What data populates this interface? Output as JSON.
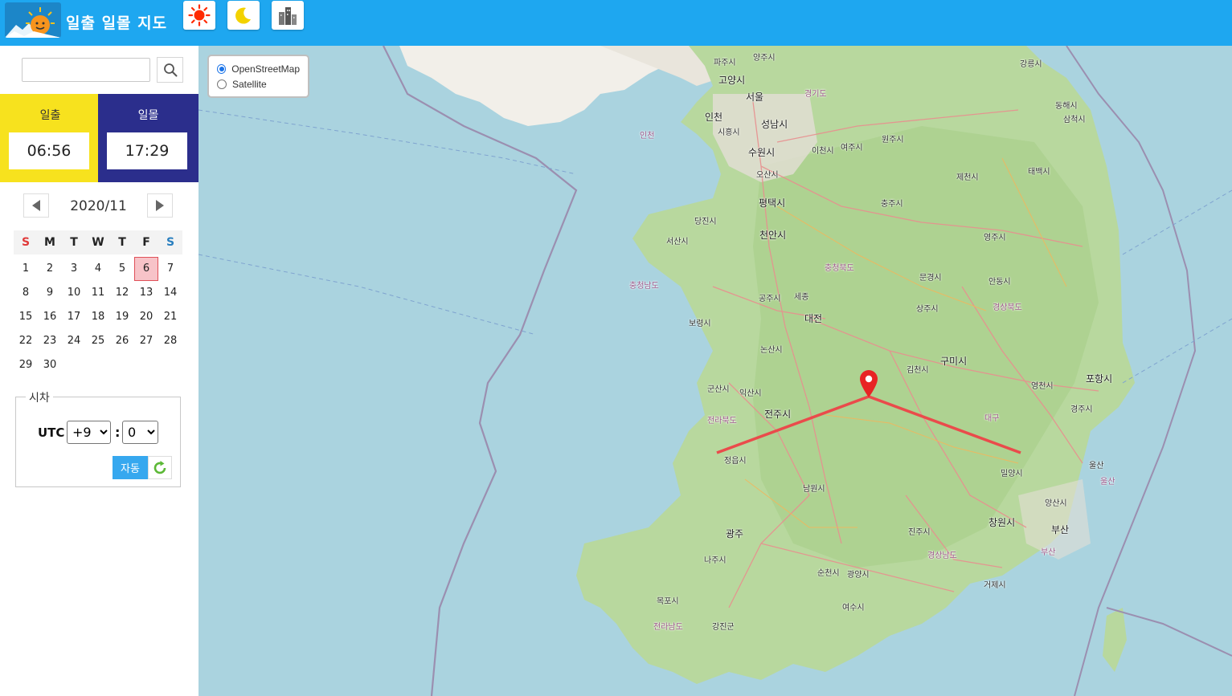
{
  "header": {
    "title": "일출 일몰 지도",
    "buttons": [
      {
        "icon": "sun-icon",
        "color": "#ff2a00"
      },
      {
        "icon": "moon-icon",
        "color": "#f3d200"
      },
      {
        "icon": "building-icon",
        "color": "#666666"
      }
    ],
    "bg_color": "#1ea7f0"
  },
  "search": {
    "value": "",
    "placeholder": ""
  },
  "sunrise": {
    "label": "일출",
    "time": "06:56",
    "color": "#f7e21e"
  },
  "sunset": {
    "label": "일몰",
    "time": "17:29",
    "color": "#2b2e8c"
  },
  "calendar": {
    "month_label": "2020/11",
    "weekdays": [
      "S",
      "M",
      "T",
      "W",
      "T",
      "F",
      "S"
    ],
    "weeks": [
      [
        "1",
        "2",
        "3",
        "4",
        "5",
        "6",
        "7"
      ],
      [
        "8",
        "9",
        "10",
        "11",
        "12",
        "13",
        "14"
      ],
      [
        "15",
        "16",
        "17",
        "18",
        "19",
        "20",
        "21"
      ],
      [
        "22",
        "23",
        "24",
        "25",
        "26",
        "27",
        "28"
      ],
      [
        "29",
        "30",
        "",
        "",
        "",
        "",
        ""
      ]
    ],
    "selected_day": "6"
  },
  "timezone": {
    "legend": "시차",
    "utc_label": "UTC",
    "hour_value": "+9",
    "colon": ":",
    "minute_value": "0",
    "auto_label": "자동"
  },
  "map": {
    "layers": [
      {
        "label": "OpenStreetMap",
        "selected": true
      },
      {
        "label": "Satellite",
        "selected": false
      }
    ],
    "places": {
      "p0": "파주시",
      "p1": "양주시",
      "p2": "고양시",
      "p3": "서울",
      "p4": "경기도",
      "p5": "강릉시",
      "p6": "동해시",
      "p7": "삼척시",
      "p8": "인천",
      "p9": "시흥시",
      "p10": "성남시",
      "p11": "인천",
      "p12": "수원시",
      "p13": "이천시",
      "p14": "여주시",
      "p15": "원주시",
      "p16": "오산시",
      "p17": "제천시",
      "p18": "태백시",
      "p19": "평택시",
      "p20": "충주시",
      "p21": "당진시",
      "p22": "서산시",
      "p23": "천안시",
      "p24": "영주시",
      "p25": "충청북도",
      "p26": "충청남도",
      "p27": "문경시",
      "p28": "안동시",
      "p29": "공주시",
      "p30": "세종",
      "p31": "상주시",
      "p32": "경상북도",
      "p33": "보령시",
      "p34": "대전",
      "p35": "논산시",
      "p36": "구미시",
      "p37": "김천시",
      "p38": "포항시",
      "p39": "군산시",
      "p40": "익산시",
      "p41": "영천시",
      "p42": "전주시",
      "p43": "전라북도",
      "p44": "대구",
      "p45": "경주시",
      "p46": "정읍시",
      "p47": "밀양시",
      "p48": "울산",
      "p49": "울산",
      "p50": "남원시",
      "p51": "양산시",
      "p52": "광주",
      "p53": "진주시",
      "p54": "창원시",
      "p55": "부산",
      "p56": "나주시",
      "p57": "경상남도",
      "p58": "부산",
      "p59": "순천시",
      "p60": "광양시",
      "p61": "거제시",
      "p62": "목포시",
      "p63": "여수시",
      "p64": "전라남도",
      "p65": "강진군"
    }
  }
}
